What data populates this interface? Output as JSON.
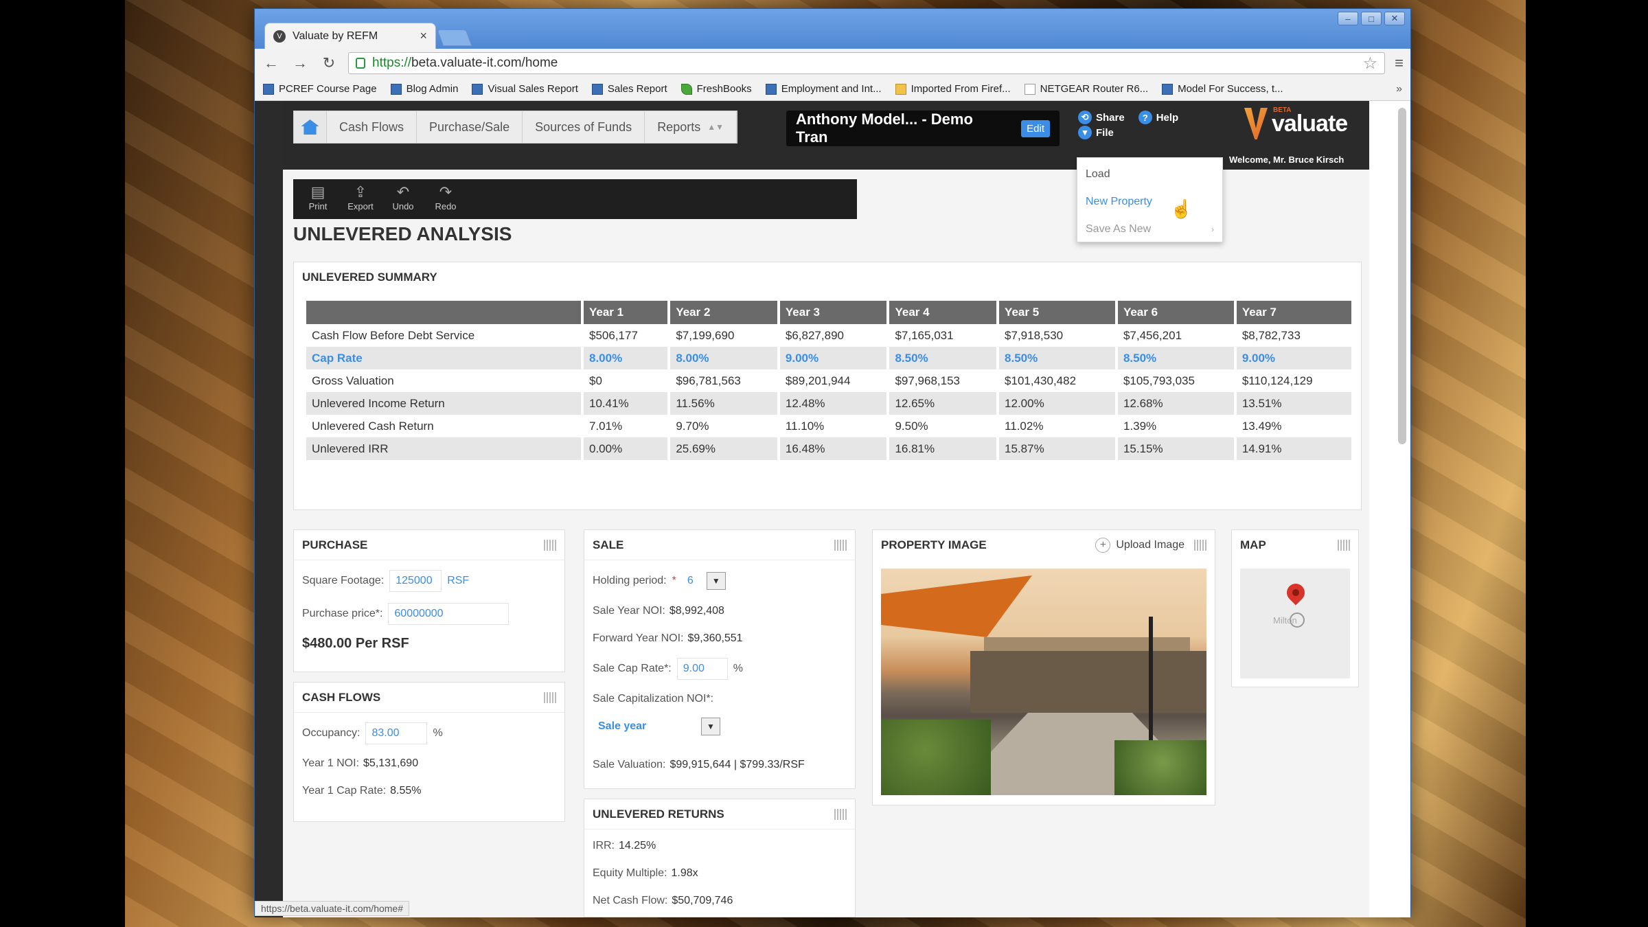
{
  "browser": {
    "tab_title": "Valuate by REFM",
    "url_scheme": "https://",
    "url_rest": "beta.valuate-it.com/home",
    "status_url": "https://beta.valuate-it.com/home#",
    "bookmarks": [
      {
        "label": "PCREF Course Page",
        "icon": "site"
      },
      {
        "label": "Blog Admin",
        "icon": "site"
      },
      {
        "label": "Visual Sales Report",
        "icon": "site"
      },
      {
        "label": "Sales Report",
        "icon": "site"
      },
      {
        "label": "FreshBooks",
        "icon": "leaf"
      },
      {
        "label": "Employment and Int...",
        "icon": "site"
      },
      {
        "label": "Imported From Firef...",
        "icon": "folder"
      },
      {
        "label": "NETGEAR Router R6...",
        "icon": "page"
      },
      {
        "label": "Model For Success, t...",
        "icon": "site"
      }
    ],
    "bookmarks_more": "»"
  },
  "app": {
    "nav": [
      "Cash Flows",
      "Purchase/Sale",
      "Sources of Funds",
      "Reports"
    ],
    "model_name": "Anthony Model... - Demo Tran",
    "edit_label": "Edit",
    "share_label": "Share",
    "help_label": "Help",
    "file_label": "File",
    "logo_beta": "BETA",
    "logo_word": "valuate",
    "welcome": "Welcome, Mr. Bruce Kirsch",
    "iconbar": [
      {
        "label": "Print",
        "glyph": "▤"
      },
      {
        "label": "Export",
        "glyph": "⇪"
      },
      {
        "label": "Undo",
        "glyph": "↶"
      },
      {
        "label": "Redo",
        "glyph": "↷"
      }
    ],
    "file_menu": [
      "Load",
      "New Property",
      "Save As New"
    ],
    "page_title": "UNLEVERED ANALYSIS"
  },
  "summary": {
    "title": "UNLEVERED SUMMARY",
    "columns": [
      "Year 1",
      "Year 2",
      "Year 3",
      "Year 4",
      "Year 5",
      "Year 6",
      "Year 7"
    ],
    "rows": [
      {
        "label": "Cash Flow Before Debt Service",
        "values": [
          "$506,177",
          "$7,199,690",
          "$6,827,890",
          "$7,165,031",
          "$7,918,530",
          "$7,456,201",
          "$8,782,733"
        ]
      },
      {
        "label": "Cap Rate",
        "values": [
          "8.00%",
          "8.00%",
          "9.00%",
          "8.50%",
          "8.50%",
          "8.50%",
          "9.00%"
        ],
        "highlight": true
      },
      {
        "label": "Gross Valuation",
        "values": [
          "$0",
          "$96,781,563",
          "$89,201,944",
          "$97,968,153",
          "$101,430,482",
          "$105,793,035",
          "$110,124,129"
        ]
      },
      {
        "label": "Unlevered Income Return",
        "values": [
          "10.41%",
          "11.56%",
          "12.48%",
          "12.65%",
          "12.00%",
          "12.68%",
          "13.51%"
        ]
      },
      {
        "label": "Unlevered Cash Return",
        "values": [
          "7.01%",
          "9.70%",
          "11.10%",
          "9.50%",
          "11.02%",
          "1.39%",
          "13.49%"
        ]
      },
      {
        "label": "Unlevered IRR",
        "values": [
          "0.00%",
          "25.69%",
          "16.48%",
          "16.81%",
          "15.87%",
          "15.15%",
          "14.91%"
        ]
      }
    ]
  },
  "purchase": {
    "title": "PURCHASE",
    "sqft_label": "Square Footage:",
    "sqft_value": "125000",
    "sqft_unit": "RSF",
    "price_label": "Purchase price*:",
    "price_value": "60000000",
    "per_rsf": "$480.00 Per RSF"
  },
  "cashflows": {
    "title": "CASH FLOWS",
    "occupancy_label": "Occupancy:",
    "occupancy_value": "83.00",
    "occupancy_unit": "%",
    "noi_label": "Year 1 NOI:",
    "noi_value": "$5,131,690",
    "cap_label": "Year 1 Cap Rate:",
    "cap_value": "8.55%"
  },
  "sale": {
    "title": "SALE",
    "holding_label": "Holding period:",
    "holding_req": "*",
    "holding_value": "6",
    "sale_noi_label": "Sale Year NOI:",
    "sale_noi_value": "$8,992,408",
    "fwd_noi_label": "Forward Year NOI:",
    "fwd_noi_value": "$9,360,551",
    "cap_label": "Sale Cap Rate*:",
    "cap_value": "9.00",
    "cap_unit": "%",
    "capnoi_label": "Sale Capitalization NOI*:",
    "capnoi_value": "Sale year",
    "valuation_label": "Sale Valuation:",
    "valuation_value": "$99,915,644 | $799.33/RSF"
  },
  "returns": {
    "title": "UNLEVERED RETURNS",
    "irr_label": "IRR:",
    "irr_value": "14.25%",
    "em_label": "Equity Multiple:",
    "em_value": "1.98x",
    "ncf_label": "Net Cash Flow:",
    "ncf_value": "$50,709,746"
  },
  "image_panel": {
    "title": "PROPERTY IMAGE",
    "upload_label": "Upload Image"
  },
  "map_panel": {
    "title": "MAP",
    "place": "Milton"
  }
}
